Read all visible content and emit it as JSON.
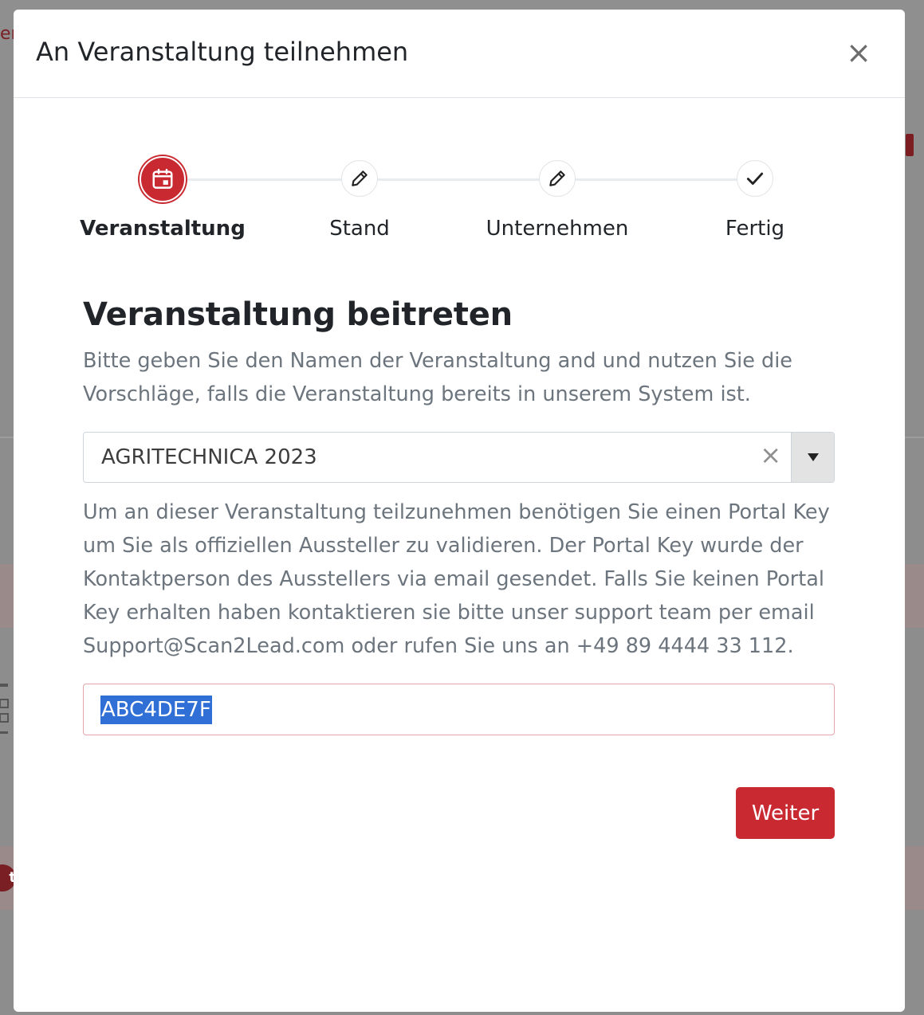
{
  "modal": {
    "title": "An Veranstaltung teilnehmen",
    "close_label": "×"
  },
  "stepper": {
    "steps": [
      {
        "label": "Veranstaltung",
        "icon": "calendar-icon",
        "active": true
      },
      {
        "label": "Stand",
        "icon": "pencil-icon",
        "active": false
      },
      {
        "label": "Unternehmen",
        "icon": "pencil-icon",
        "active": false
      },
      {
        "label": "Fertig",
        "icon": "check-icon",
        "active": false
      }
    ]
  },
  "content": {
    "title": "Veranstaltung beitreten",
    "intro": "Bitte geben Sie den Namen der Veranstaltung and und nutzen Sie die Vorschläge, falls die Veranstaltung bereits in unserem System ist.",
    "event_select": {
      "value": "AGRITECHNICA 2023",
      "clear_label": "×"
    },
    "info": "Um an dieser Veranstaltung teilzunehmen benötigen Sie einen Portal Key um Sie als offiziellen Aussteller zu validieren. Der Portal Key wurde der Kontaktperson des Ausstellers via email gesendet. Falls Sie keinen Portal Key erhalten haben kontaktieren sie bitte unser support team per email Support@Scan2Lead.com oder rufen Sie uns an +49 89 4444 33 112.",
    "portal_key": {
      "value": "ABC4DE7F"
    },
    "next_label": "Weiter"
  },
  "background": {
    "left_text": "er",
    "badge_text": "t"
  },
  "colors": {
    "accent": "#c92a32",
    "selection": "#2f6fd6",
    "muted_text": "#6c757d"
  }
}
